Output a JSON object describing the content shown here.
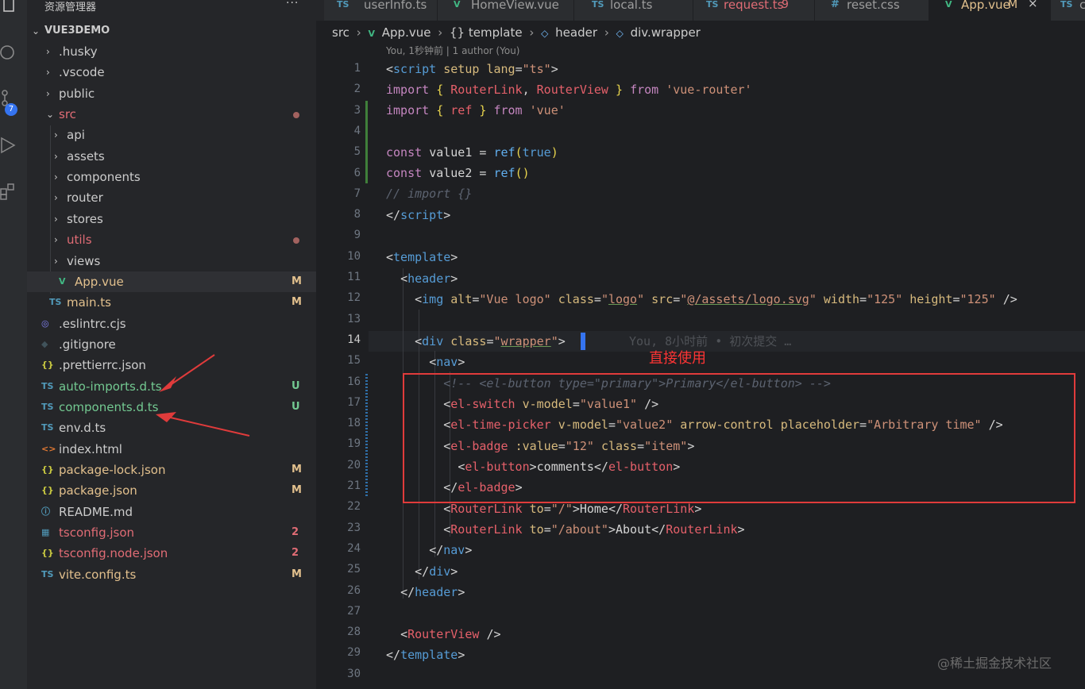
{
  "sidebar": {
    "title": "资源管理器",
    "more": "···",
    "project": "VUE3DEMO",
    "items": [
      {
        "name": ".husky",
        "type": "folder"
      },
      {
        "name": ".vscode",
        "type": "folder"
      },
      {
        "name": "public",
        "type": "folder"
      },
      {
        "name": "src",
        "type": "folder-open",
        "color": "#e06c75",
        "dot": true
      },
      {
        "name": "api",
        "type": "folder"
      },
      {
        "name": "assets",
        "type": "folder"
      },
      {
        "name": "components",
        "type": "folder"
      },
      {
        "name": "router",
        "type": "folder"
      },
      {
        "name": "stores",
        "type": "folder"
      },
      {
        "name": "utils",
        "type": "folder",
        "color": "#e06c75",
        "dot": true
      },
      {
        "name": "views",
        "type": "folder"
      },
      {
        "name": "App.vue",
        "type": "vue",
        "badge": "M"
      },
      {
        "name": "main.ts",
        "type": "ts",
        "badge": "M"
      },
      {
        "name": ".eslintrc.cjs",
        "type": "eslint"
      },
      {
        "name": ".gitignore",
        "type": "git"
      },
      {
        "name": ".prettierrc.json",
        "type": "json"
      },
      {
        "name": "auto-imports.d.ts",
        "type": "ts",
        "badge": "U"
      },
      {
        "name": "components.d.ts",
        "type": "ts",
        "badge": "U"
      },
      {
        "name": "env.d.ts",
        "type": "ts"
      },
      {
        "name": "index.html",
        "type": "html"
      },
      {
        "name": "package-lock.json",
        "type": "json",
        "badge": "M"
      },
      {
        "name": "package.json",
        "type": "json",
        "badge": "M"
      },
      {
        "name": "README.md",
        "type": "info"
      },
      {
        "name": "tsconfig.json",
        "type": "tsjson",
        "badge": "2"
      },
      {
        "name": "tsconfig.node.json",
        "type": "json",
        "badge": "2"
      },
      {
        "name": "vite.config.ts",
        "type": "ts",
        "badge": "M"
      }
    ],
    "activity_badge": "7"
  },
  "tabs": [
    {
      "label": "userInfo.ts",
      "icon": "TS"
    },
    {
      "label": "HomeView.vue",
      "icon": "V"
    },
    {
      "label": "local.ts",
      "icon": "TS"
    },
    {
      "label": "request.ts",
      "icon": "TS",
      "mark": "9"
    },
    {
      "label": "reset.css",
      "icon": "#"
    },
    {
      "label": "App.vue",
      "icon": "V",
      "mark": "M",
      "close": "×"
    },
    {
      "label": "c",
      "icon": "TS"
    }
  ],
  "breadcrumb": [
    "src",
    "App.vue",
    "{} template",
    "header",
    "div.wrapper"
  ],
  "codelens": "You, 1秒钟前 | 1 author (You)",
  "blame": "You, 8小时前 • 初次提交 …",
  "annotation": "直接使用",
  "watermark": "@稀土掘金技术社区",
  "line_numbers": [
    "1",
    "2",
    "3",
    "4",
    "5",
    "6",
    "7",
    "8",
    "9",
    "10",
    "11",
    "12",
    "13",
    "14",
    "15",
    "16",
    "17",
    "18",
    "19",
    "20",
    "21",
    "22",
    "23",
    "24",
    "25",
    "26",
    "27",
    "28",
    "29",
    "30"
  ],
  "colors": {
    "accent": "#3574f0",
    "annotation": "#ff3434",
    "modified": "#e2c08d",
    "untracked": "#73c991",
    "error": "#e06c75"
  }
}
